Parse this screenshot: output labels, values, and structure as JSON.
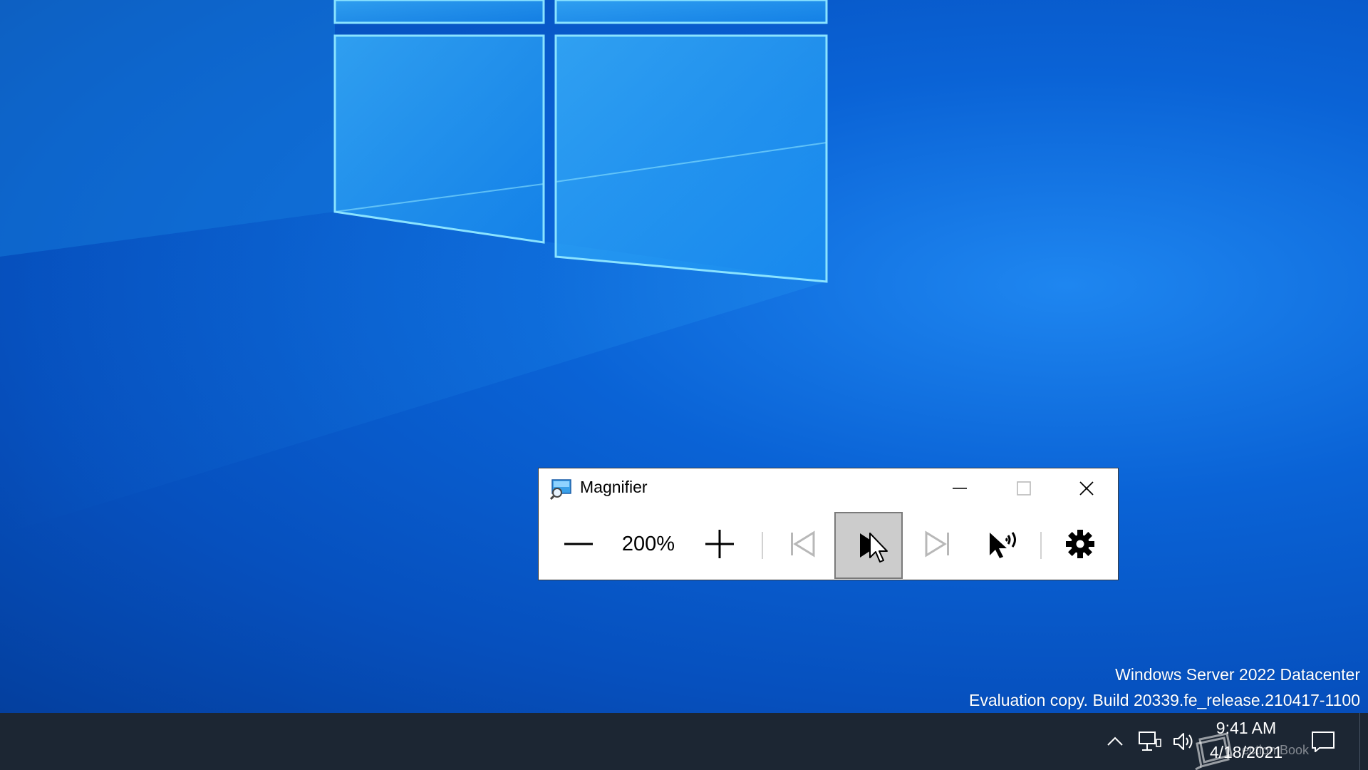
{
  "magnifier": {
    "title": "Magnifier",
    "zoom_level": "200%",
    "toolbar": {
      "zoom_out_icon": "minus-icon",
      "zoom_in_icon": "plus-icon",
      "previous_icon": "skip-previous-icon",
      "play_icon": "play-icon",
      "next_icon": "skip-next-icon",
      "read_from_here_icon": "pointer-speaker-icon",
      "settings_icon": "gear-icon",
      "play_state": "hovered"
    },
    "caption_buttons": [
      "minimize-icon",
      "maximize-icon",
      "close-icon"
    ]
  },
  "watermark": {
    "line1": "Windows Server 2022 Datacenter",
    "line2": "Evaluation copy. Build 20339.fe_release.210417-1100"
  },
  "taskbar": {
    "tray_icons": [
      "chevron-up-icon",
      "network-icon",
      "volume-icon"
    ],
    "clock_time": "9:41 AM",
    "clock_date": "4/18/2021",
    "overlay_text": "ection Book",
    "action_center_icon": "notification-icon"
  },
  "colors": {
    "desktop_accent": "#0a63d6",
    "window_background": "#ffffff",
    "taskbar": "#1c2633",
    "play_highlight": "#cccccc"
  }
}
